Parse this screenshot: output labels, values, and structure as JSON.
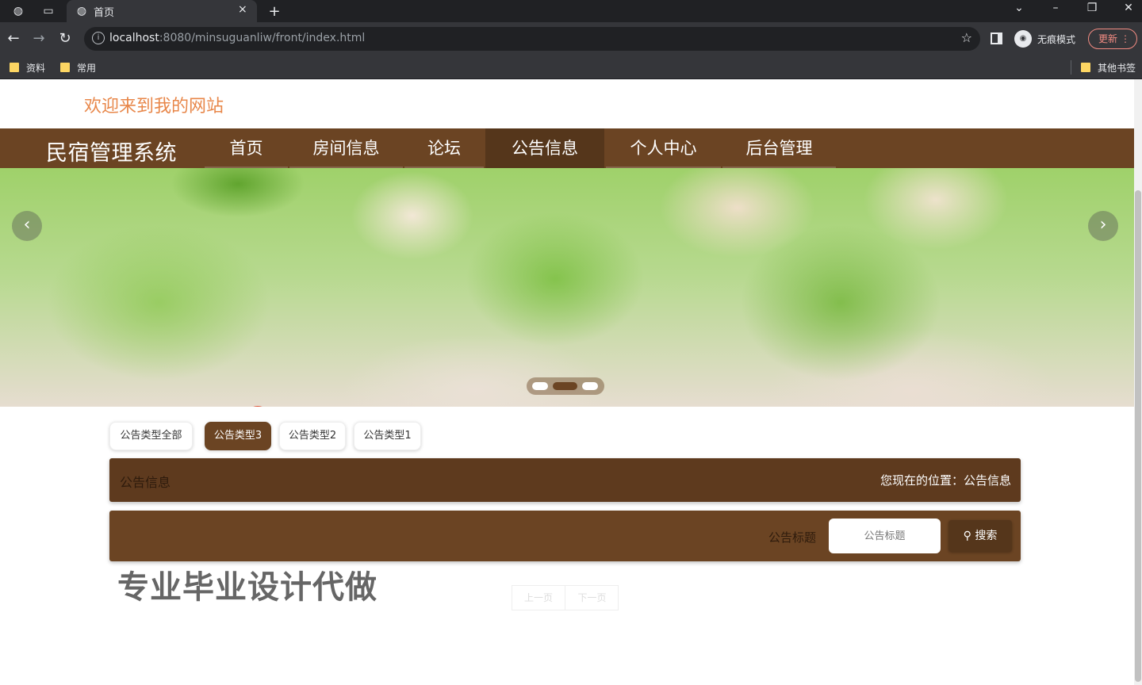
{
  "browser": {
    "tab_title": "首页",
    "tab_close": "×",
    "new_tab": "+",
    "url_host": "localhost",
    "url_path": ":8080/minsuguanliw/front/index.html",
    "incognito_label": "无痕模式",
    "update_label": "更新",
    "bookmarks": [
      "资料",
      "常用"
    ],
    "other_bookmarks": "其他书签"
  },
  "site": {
    "welcome": "欢迎来到我的网站",
    "brand": "民宿管理系统",
    "nav": [
      {
        "label": "首页",
        "active": false
      },
      {
        "label": "房间信息",
        "active": false
      },
      {
        "label": "论坛",
        "active": false
      },
      {
        "label": "公告信息",
        "active": true
      },
      {
        "label": "个人中心",
        "active": false
      },
      {
        "label": "后台管理",
        "active": false
      }
    ],
    "carousel": {
      "slides": 3,
      "active_index": 1
    }
  },
  "filters": [
    {
      "label": "公告类型全部",
      "active": false
    },
    {
      "label": "公告类型3",
      "active": true
    },
    {
      "label": "公告类型2",
      "active": false
    },
    {
      "label": "公告类型1",
      "active": false
    }
  ],
  "section": {
    "title": "公告信息",
    "location": "您现在的位置：公告信息"
  },
  "search": {
    "label": "公告标题",
    "placeholder": "公告标题",
    "button": "搜索"
  },
  "watermark": "专业毕业设计代做",
  "pager": {
    "prev": "上一页",
    "next": "下一页"
  },
  "colors": {
    "brand_brown": "#6b4423",
    "active_brown": "#55361b",
    "welcome_orange": "#e8874a"
  }
}
